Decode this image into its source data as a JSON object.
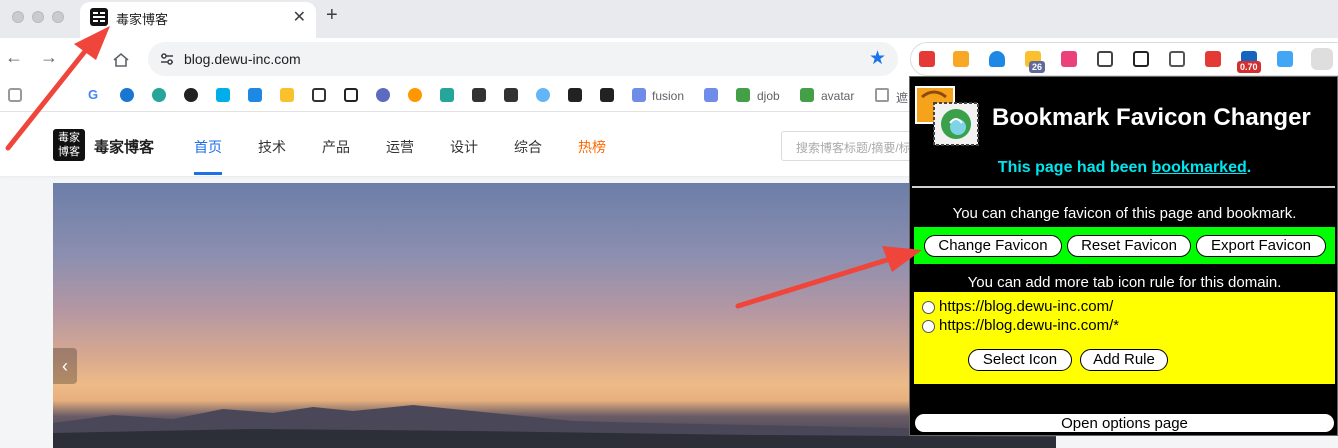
{
  "browser": {
    "tab": {
      "title": "毒家博客"
    },
    "url": "blog.dewu-inc.com",
    "extension_badges": [
      "26",
      "0.70"
    ],
    "bookmarks": [
      "fusion",
      "djob",
      "avatar",
      "遮"
    ]
  },
  "site": {
    "logo_text": [
      "毒家",
      "博客"
    ],
    "name": "毒家博客",
    "nav": [
      "首页",
      "技术",
      "产品",
      "运营",
      "设计",
      "综合",
      "热榜"
    ],
    "search_placeholder": "搜索博客标题/摘要/标签"
  },
  "popup": {
    "title": "Bookmark Favicon Changer",
    "status_prefix": "This page had been ",
    "status_link": "bookmarked",
    "status_suffix": ".",
    "change_text": "You can change favicon of this page and bookmark.",
    "buttons": {
      "change": "Change Favicon",
      "reset": "Reset Favicon",
      "export": "Export Favicon"
    },
    "rule_text": "You can add more tab icon rule for this domain.",
    "rules": [
      "https://blog.dewu-inc.com/",
      "https://blog.dewu-inc.com/*"
    ],
    "select_icon": "Select Icon",
    "add_rule": "Add Rule",
    "options": "Open options page"
  },
  "colors": {
    "accent": "#1f6feb",
    "hot": "#ff6a00",
    "status_cyan": "#00e5ee",
    "green_box": "#00ff00",
    "yellow_box": "#ffff00",
    "arrow_red": "#f0453a"
  }
}
